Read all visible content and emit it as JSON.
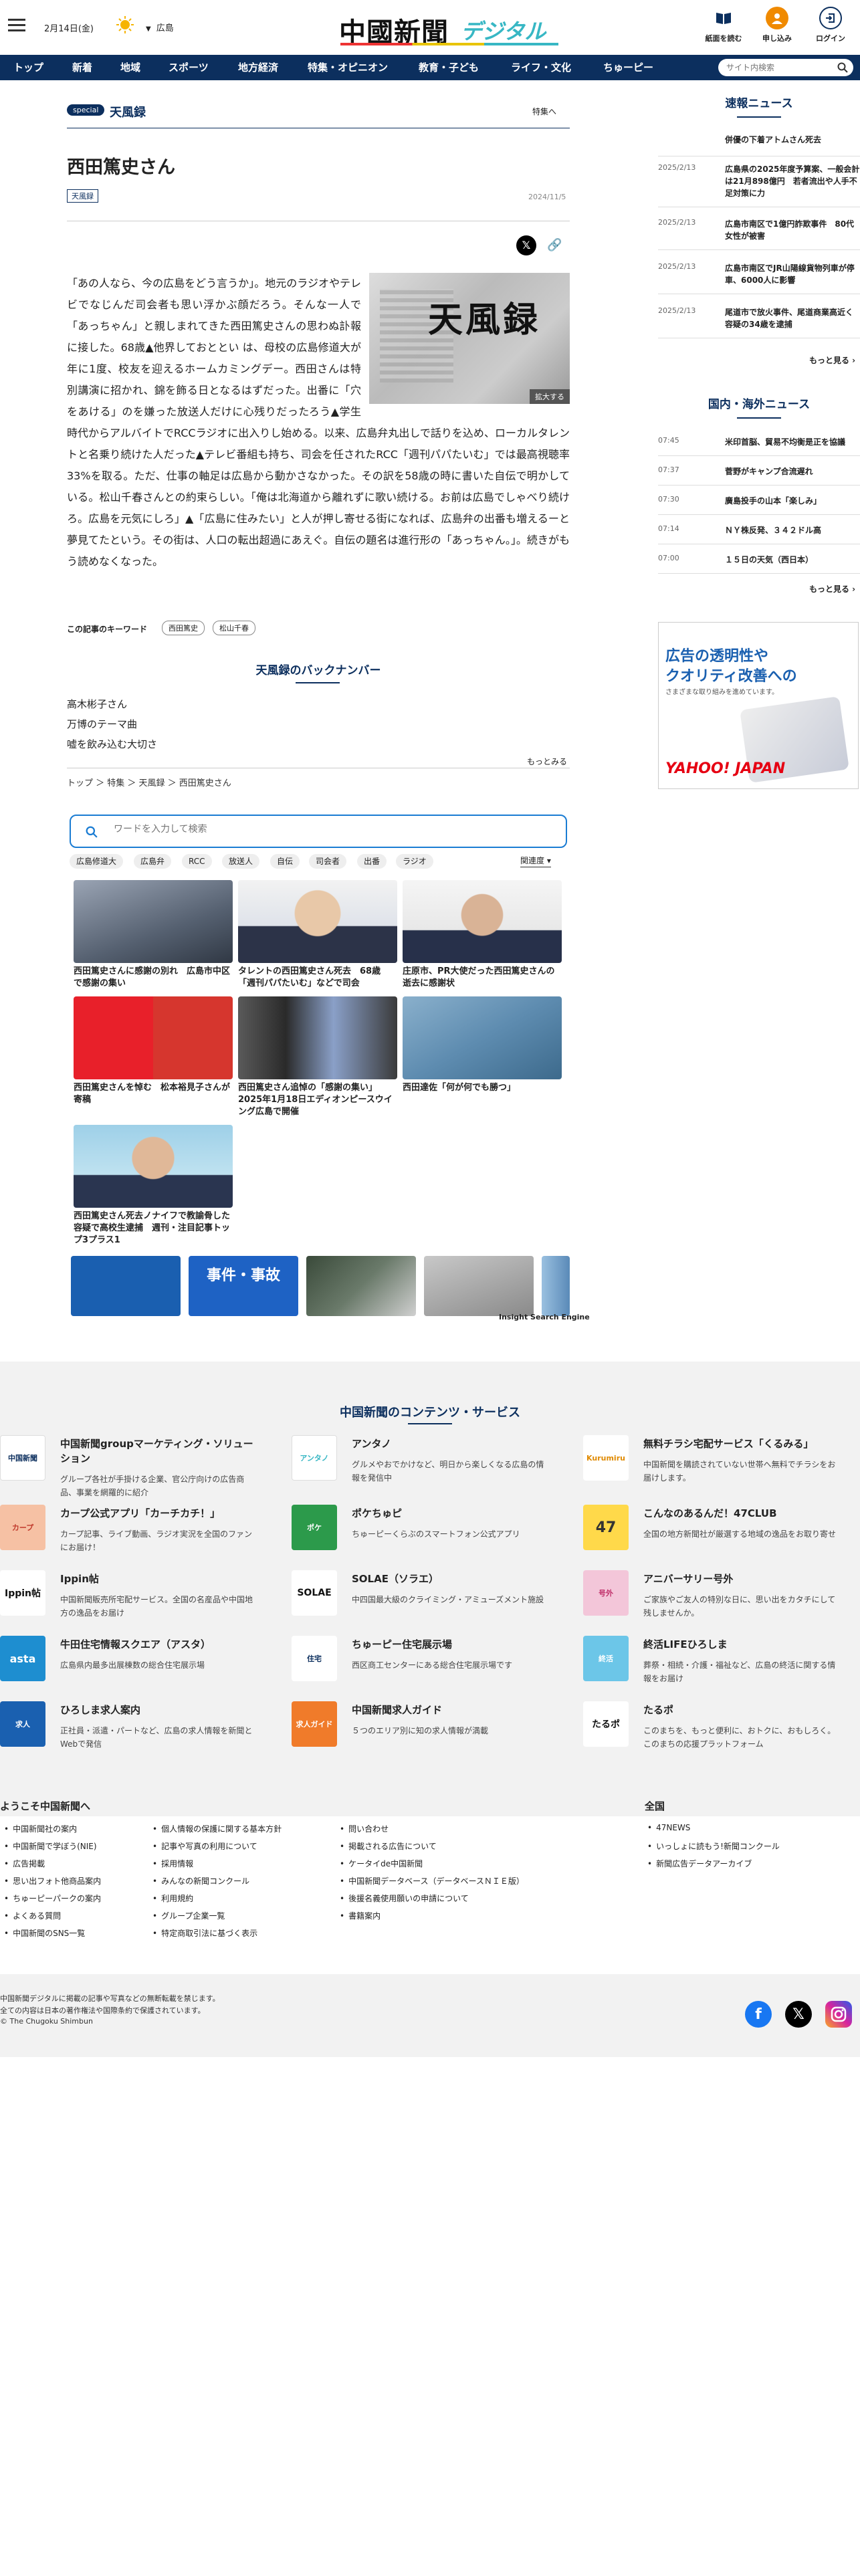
{
  "header": {
    "date": "2月14日(金)",
    "weather": "sun-icon",
    "region": "広島",
    "logo_main": "中國新聞",
    "logo_sub": "デジタル",
    "buttons": [
      {
        "label": "紙面を読む",
        "icon": "newspaper-icon"
      },
      {
        "label": "申し込み",
        "icon": "subscribe-icon"
      },
      {
        "label": "ログイン",
        "icon": "login-icon"
      }
    ],
    "accent": "#0c2f5e"
  },
  "nav": {
    "items": [
      "トップ",
      "新着",
      "地域",
      "スポーツ",
      "地方経済",
      "特集・オピニオン",
      "教育・子ども",
      "ライフ・文化",
      "ちゅーピー"
    ],
    "search_placeholder": "サイト内検索"
  },
  "article": {
    "badge": "special",
    "series": "天風録",
    "to_special": "特集へ",
    "title": "西田篤史さん",
    "tag": "天風録",
    "date": "2024/11/5",
    "image_text": "天風録",
    "enlarge": "拡大する",
    "body": "「あの人なら、今の広島をどう言うか」。地元のラジオやテレビでなじんだ司会者も思い浮かぶ顔だろう。そんな一人で「あっちゃん」と親しまれてきた西田篤史さんの思わぬ訃報に接した。68歳▲他界しておととい は、母校の広島修道大が年に1度、校友を迎えるホームカミングデー。西田さんは特別講演に招かれ、錦を飾る日となるはずだった。出番に「穴をあける」のを嫌った放送人だけに心残りだったろう▲学生時代からアルバイトでRCCラジオに出入りし始める。以来、広島弁丸出しで話りを込め、ローカルタレントと名乗り続けた人だった▲テレビ番組も持ち、司会を任されたRCC「週刊パパたいむ」では最高視聴率33%を取る。ただ、仕事の軸足は広島から動かさなかった。その訳を58歳の時に書いた自伝で明かしている。松山千春さんとの約束らしい。「俺は北海道から離れずに歌い続ける。お前は広島でしゃべり続けろ。広島を元気にしろ」▲「広島に住みたい」と人が押し寄せる街になれば、広島弁の出番も増えるーと夢見てたという。その街は、人口の転出超過にあえぐ。自伝の題名は進行形の「あっちゃん。」。続きがもう読めなくなった。",
    "keywords_label": "この記事のキーワード",
    "keywords": [
      "西田篤史",
      "松山千春"
    ]
  },
  "backnumber": {
    "title": "天風録のバックナンバー",
    "items": [
      "高木彬子さん",
      "万博のテーマ曲",
      "嘘を飲み込む大切さ"
    ],
    "more": "もっとみる"
  },
  "breadcrumb": "トップ ＞ 特集 ＞ 天風録 ＞ 西田篤史さん",
  "related_search": {
    "placeholder": "ワードを入力して検索",
    "chips": [
      "広島修道大",
      "広島弁",
      "RCC",
      "放送人",
      "自伝",
      "司会者",
      "出番",
      "ラジオ"
    ],
    "sort": "関連度",
    "cards": [
      "西田篤史さんに感謝の別れ　広島市中区で感謝の集い",
      "タレントの西田篤史さん死去　68歳「週刊パパたいむ」などで司会",
      "庄原市、PR大使だった西田篤史さんの逝去に感謝状",
      "西田篤史さんを悼む　松本裕見子さんが寄稿",
      "西田篤史さん追悼の「感謝の集い」2025年1月18日エディオンピースウイング広島で開催",
      "西田達佐「何が何でも勝つ」",
      "西田篤史さん死去ノナイフで教諭骨した容疑で高校生逮捕　週刊・注目記事トップ3プラス1"
    ],
    "strip_labels": [
      "",
      "事件・事故",
      "",
      "",
      ""
    ],
    "engine": "Insight Search Engine"
  },
  "sidebar": {
    "express_title": "速報ニュース",
    "express": [
      {
        "date": "",
        "title": "併優の下着アトムさん死去"
      },
      {
        "date": "2025/2/13",
        "title": "広島県の2025年度予算案、一般会計は21月898億円　若者流出や人手不足対策に力"
      },
      {
        "date": "2025/2/13",
        "title": "広島市南区で1億円詐欺事件　80代女性が被害"
      },
      {
        "date": "2025/2/13",
        "title": "広島市南区でJR山陽線貨物列車が停車、6000人に影響"
      },
      {
        "date": "2025/2/13",
        "title": "尾道市で放火事件、尾道商業高近く容疑の34歳を逮捕"
      }
    ],
    "more": "もっと見る ›",
    "world_title": "国内・海外ニュース",
    "world": [
      {
        "date": "07:45",
        "title": "米印首脳、貿易不均衡是正を協議"
      },
      {
        "date": "07:37",
        "title": "菅野がキャンプ合流遅れ"
      },
      {
        "date": "07:30",
        "title": "廣島投手の山本「楽しみ」"
      },
      {
        "date": "07:14",
        "title": "ＮＹ株反発、３４２ドル高"
      },
      {
        "date": "07:00",
        "title": "１５日の天気（西日本）"
      }
    ],
    "ad": {
      "l1": "広告の透明性や",
      "l2": "クオリティ改善への",
      "l3": "さまざまな取り組みを進めています。",
      "brand": "YAHOO! JAPAN"
    }
  },
  "services": {
    "title": "中国新聞のコンテンツ・サービス",
    "items": [
      {
        "name": "中国新聞groupマーケティング・ソリューション",
        "desc": "グループ各社が手掛ける企業、官公庁向けの広告商品、事業を網羅的に紹介",
        "logo": "中国新聞",
        "color": "#ffffff"
      },
      {
        "name": "アンタノ",
        "desc": "グルメやおでかけなど、明日から楽しくなる広島の情報を発信中",
        "logo": "アンタノ",
        "color": "#ffffff"
      },
      {
        "name": "無料チラシ宅配サービス「くるみる」",
        "desc": "中国新聞を購読されていない世帯へ無料でチラシをお届けします。",
        "logo": "Kurumiru",
        "color": "#ffffff"
      },
      {
        "name": "カープ公式アプリ「カーチカチ！」",
        "desc": "カープ記事、ライブ動画、ラジオ実況を全国のファンにお届け！",
        "logo": "カープ",
        "color": "#f6c1a4"
      },
      {
        "name": "ポケちゅピ",
        "desc": "ちゅーピーくらぶのスマートフォン公式アプリ",
        "logo": "ポケ",
        "color": "#2c9a4b"
      },
      {
        "name": "こんなのあるんだ！47CLUB",
        "desc": "全国の地方新聞社が厳選する地域の逸品をお取り寄せ",
        "logo": "47",
        "color": "#ffd94a"
      },
      {
        "name": "Ippin帖",
        "desc": "中国新聞販売所宅配サービス。全国の名産品や中国地方の逸品をお届け",
        "logo": "Ippin帖",
        "color": "#ffffff"
      },
      {
        "name": "SOLAE（ソラエ）",
        "desc": "中四国最大級のクライミング・アミューズメント施設",
        "logo": "SOLAE",
        "color": "#ffffff"
      },
      {
        "name": "アニバーサリー号外",
        "desc": "ご家族やご友人の特別な日に、思い出をカタチにして残しませんか。",
        "logo": "号外",
        "color": "#f3c6d9"
      },
      {
        "name": "牛田住宅情報スクエア（アスタ）",
        "desc": "広島県内最多出展棟数の総合住宅展示場",
        "logo": "asta",
        "color": "#1e8ed0"
      },
      {
        "name": "ちゅーピー住宅展示場",
        "desc": "西区商工センターにある総合住宅展示場です",
        "logo": "住宅",
        "color": "#ffffff"
      },
      {
        "name": "終活LIFEひろしま",
        "desc": "葬祭・相続・介護・福祉など、広島の終活に関する情報をお届け",
        "logo": "終活",
        "color": "#6cc6e8"
      },
      {
        "name": "ひろしま求人案内",
        "desc": "正社員・派遣・パートなど、広島の求人情報を新聞とWebで発信",
        "logo": "求人",
        "color": "#1a60b0"
      },
      {
        "name": "中国新聞求人ガイド",
        "desc": "５つのエリア別に知の求人情報が満載",
        "logo": "求人ガイド",
        "color": "#f07b2a"
      },
      {
        "name": "たるポ",
        "desc": "このまちを、もっと便利に、おトクに、おもしろく。このまちの応援プラットフォーム",
        "logo": "たるポ",
        "color": "#ffffff"
      }
    ]
  },
  "footer": {
    "welcome": "ようこそ中国新聞へ",
    "col1": [
      "中国新聞社の案内",
      "中国新聞で学ぼう(NIE)",
      "広告掲載",
      "思い出フォト他商品案内",
      "ちゅーピーパークの案内",
      "よくある質問",
      "中国新聞のSNS一覧"
    ],
    "col2": [
      "個人情報の保護に関する基本方針",
      "記事や写真の利用について",
      "採用情報",
      "みんなの新聞コンクール",
      "利用規約",
      "グループ企業一覧",
      "特定商取引法に基づく表示"
    ],
    "col3": [
      "問い合わせ",
      "掲載される広告について",
      "ケータイde中国新聞",
      "中国新聞データベース（データベースＮＩＥ版）",
      "後援名義使用願いの申請について",
      "書籍案内"
    ],
    "zenkoku": "全国",
    "col4": [
      "47NEWS",
      "いっしょに読もう!新聞コンクール",
      "新聞広告データアーカイブ"
    ],
    "copy": [
      "中国新聞デジタルに掲載の記事や写真などの無断転載を禁じます。",
      "全ての内容は日本の著作権法や国際条約で保護されています。",
      "© The Chugoku Shimbun"
    ],
    "social": [
      {
        "icon": "facebook-icon",
        "color": "#1877f2"
      },
      {
        "icon": "x-icon",
        "color": "#000000"
      },
      {
        "icon": "instagram-icon",
        "color": "#d6249f"
      }
    ]
  }
}
